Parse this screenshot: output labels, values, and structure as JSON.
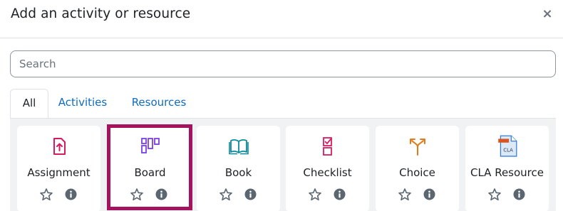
{
  "dialog": {
    "title": "Add an activity or resource",
    "close_symbol": "×"
  },
  "search": {
    "placeholder": "Search",
    "value": ""
  },
  "tabs": [
    {
      "label": "All",
      "active": true
    },
    {
      "label": "Activities",
      "active": false
    },
    {
      "label": "Resources",
      "active": false
    }
  ],
  "modules": [
    {
      "label": "Assignment",
      "icon": "assignment-icon",
      "icon_color": "#d81b60"
    },
    {
      "label": "Board",
      "icon": "board-icon",
      "icon_color": "#7b3fe4",
      "highlighted": true
    },
    {
      "label": "Book",
      "icon": "book-icon",
      "icon_color": "#0a8b9c"
    },
    {
      "label": "Checklist",
      "icon": "checklist-icon",
      "icon_color": "#d81b60"
    },
    {
      "label": "Choice",
      "icon": "choice-icon",
      "icon_color": "#e07b1a"
    },
    {
      "label": "CLA Resource",
      "icon": "cla-resource-icon",
      "icon_color": "#3a7fcf",
      "icon_text": "CLA"
    }
  ],
  "colors": {
    "highlight": "#a5125e",
    "link": "#0f6cbf",
    "panel_bg": "#f1f2f4"
  }
}
